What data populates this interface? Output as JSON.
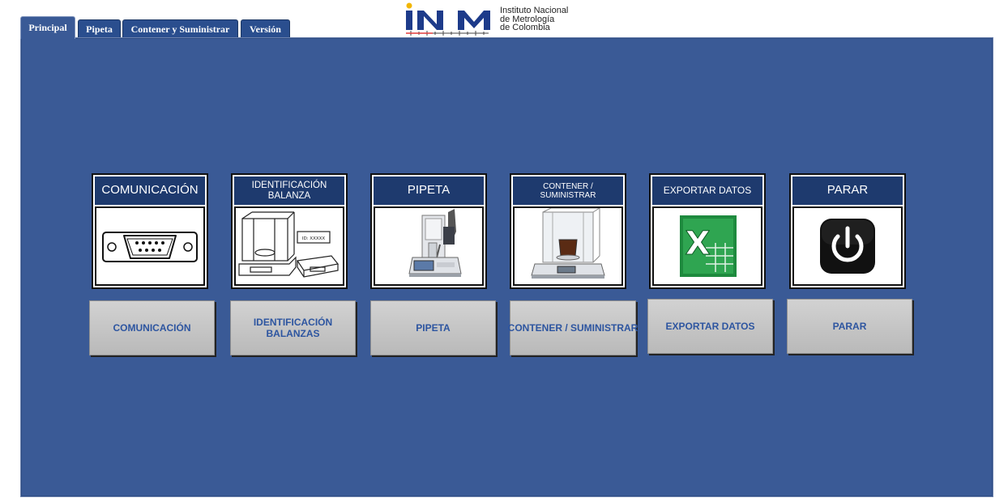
{
  "tabs": [
    "Principal",
    "Pipeta",
    "Contener y Suministrar",
    "Versión"
  ],
  "logo": {
    "line1": "Instituto Nacional",
    "line2": "de Metrología",
    "line3": "de Colombia",
    "brand_colors": {
      "i": "#1d3b8a",
      "n": "#1d3b8a",
      "m": "#1d3b8a",
      "accent": "#f2b600"
    }
  },
  "cards": [
    {
      "title": "COMUNICACIÓN",
      "icon": "serial-port-icon"
    },
    {
      "title": "IDENTIFICACIÓN BALANZA",
      "icon": "balances-icon",
      "id_label": "ID: XXXXX"
    },
    {
      "title": "PIPETA",
      "icon": "pipette-balance-icon"
    },
    {
      "title": "CONTENER / SUMINISTRAR",
      "icon": "analytical-balance-icon"
    },
    {
      "title": "EXPORTAR DATOS",
      "icon": "excel-icon"
    },
    {
      "title": "PARAR",
      "icon": "power-icon"
    }
  ],
  "buttons": [
    "COMUNICACIÓN",
    "IDENTIFICACIÓN BALANZAS",
    "PIPETA",
    "CONTENER / SUMINISTRAR",
    "EXPORTAR DATOS",
    "PARAR"
  ],
  "colors": {
    "panel": "#3a5a96",
    "card_header": "#1e3a6e",
    "button_text": "#2d55a0"
  }
}
